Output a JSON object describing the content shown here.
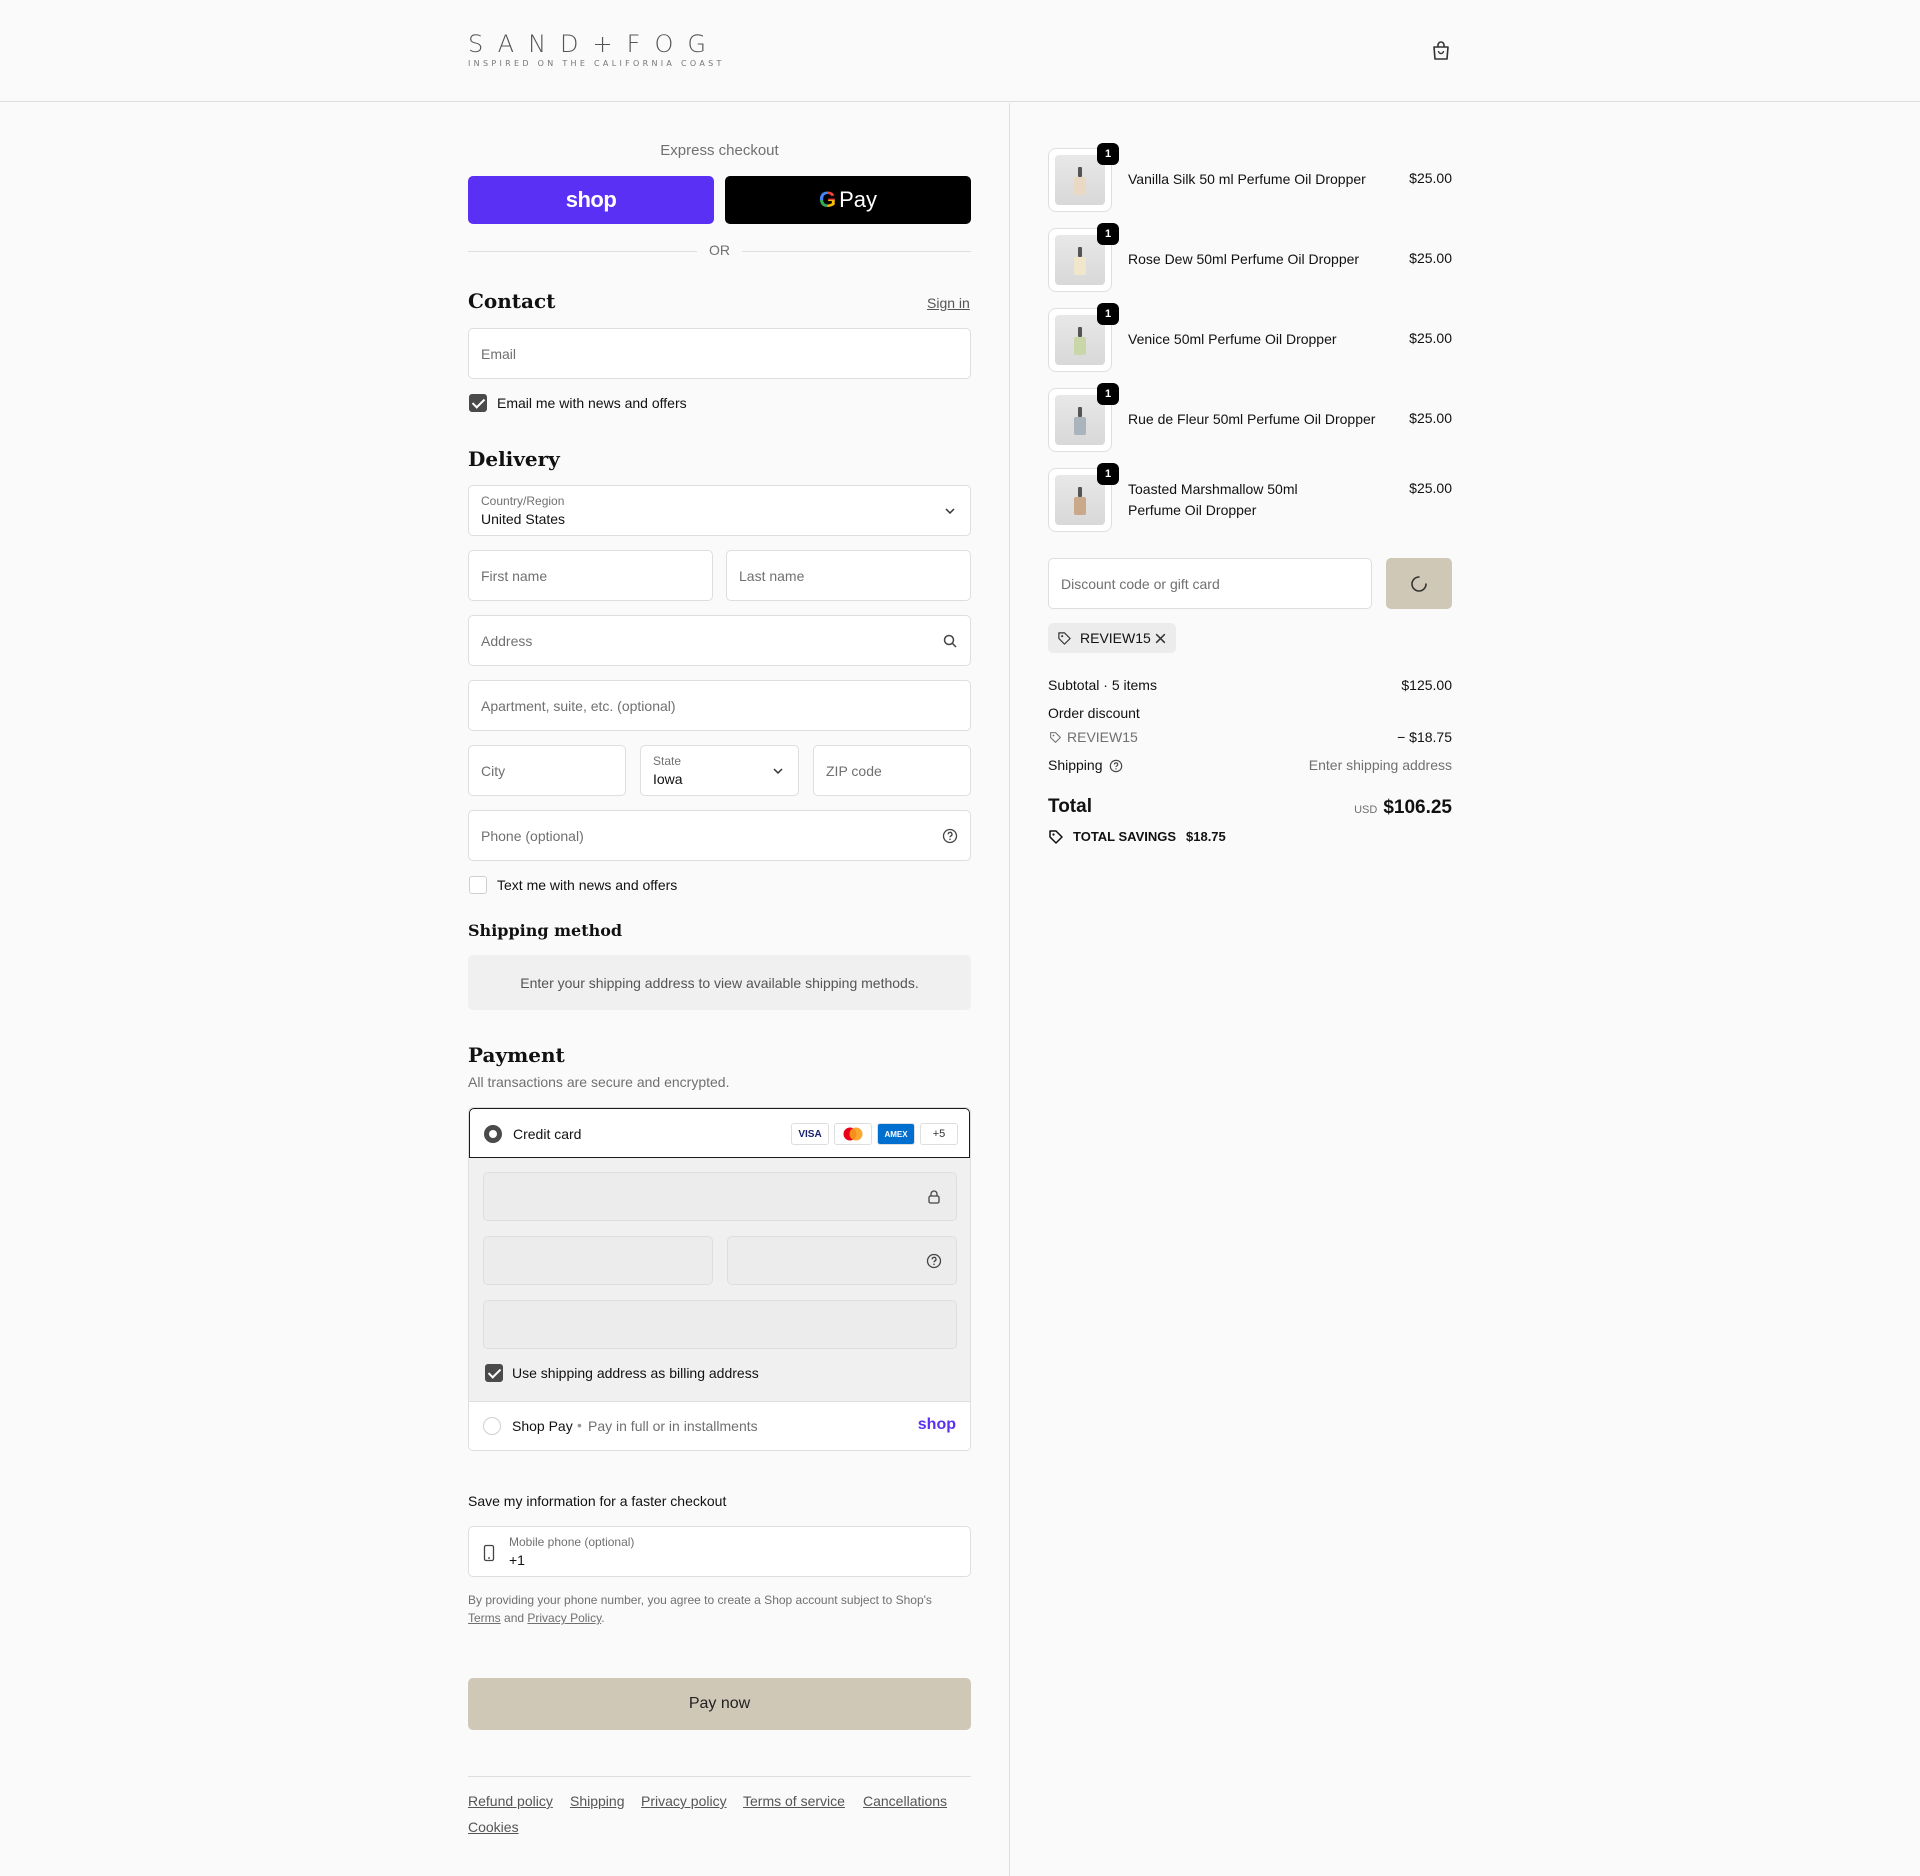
{
  "header": {
    "logo_main": "SAND+FOG",
    "logo_sub": "INSPIRED ON THE CALIFORNIA COAST"
  },
  "express": {
    "title": "Express checkout",
    "shop_label": "shop",
    "gpay_label": "Pay",
    "or": "OR"
  },
  "contact": {
    "heading": "Contact",
    "sign_in": "Sign in",
    "email_placeholder": "Email",
    "news_label": "Email me with news and offers",
    "news_checked": true
  },
  "delivery": {
    "heading": "Delivery",
    "country_label": "Country/Region",
    "country_value": "United States",
    "first_name": "First name",
    "last_name": "Last name",
    "address": "Address",
    "apartment": "Apartment, suite, etc. (optional)",
    "city": "City",
    "state_label": "State",
    "state_value": "Iowa",
    "zip": "ZIP code",
    "phone": "Phone (optional)",
    "text_label": "Text me with news and offers",
    "text_checked": false
  },
  "shipping_method": {
    "heading": "Shipping method",
    "note": "Enter your shipping address to view available shipping methods."
  },
  "payment": {
    "heading": "Payment",
    "subtext": "All transactions are secure and encrypted.",
    "credit_card": "Credit card",
    "brands": [
      "VISA",
      "MC",
      "AMEX",
      "+5"
    ],
    "billing_label": "Use shipping address as billing address",
    "shop_pay": "Shop Pay",
    "shop_pay_sub": "Pay in full or in installments",
    "shop_logo": "shop"
  },
  "save_info": {
    "heading": "Save my information for a faster checkout",
    "mobile_label": "Mobile phone (optional)",
    "mobile_value": "+1",
    "legal_1": "By providing your phone number, you agree to create a Shop account subject to Shop's",
    "terms": "Terms",
    "and": "and",
    "privacy": "Privacy Policy",
    "period": "."
  },
  "pay_now": "Pay now",
  "footer_links": [
    "Refund policy",
    "Shipping",
    "Privacy policy",
    "Terms of service",
    "Cancellations",
    "Cookies"
  ],
  "cart": {
    "items": [
      {
        "name": "Vanilla Silk 50 ml Perfume Oil Dropper",
        "price": "$25.00",
        "qty": "1",
        "color": "#e9d9c4"
      },
      {
        "name": "Rose Dew 50ml Perfume Oil Dropper",
        "price": "$25.00",
        "qty": "1",
        "color": "#efe6cc"
      },
      {
        "name": "Venice 50ml Perfume Oil Dropper",
        "price": "$25.00",
        "qty": "1",
        "color": "#c8d6a8"
      },
      {
        "name": "Rue de Fleur 50ml Perfume Oil Dropper",
        "price": "$25.00",
        "qty": "1",
        "color": "#a9b4bd"
      },
      {
        "name": "Toasted Marshmallow 50ml Perfume Oil Dropper",
        "price": "$25.00",
        "qty": "1",
        "color": "#c9a98a"
      }
    ],
    "discount_placeholder": "Discount code or gift card",
    "applied_code": "REVIEW15",
    "subtotal_label": "Subtotal · 5 items",
    "subtotal_value": "$125.00",
    "order_discount": "Order discount",
    "discount_code": "REVIEW15",
    "discount_value": "− $18.75",
    "shipping_label": "Shipping",
    "shipping_value": "Enter shipping address",
    "total_label": "Total",
    "currency": "USD",
    "total_value": "$106.25",
    "savings_label": "TOTAL SAVINGS",
    "savings_value": "$18.75"
  },
  "colors": {
    "shop_purple": "#5a31f4",
    "pay_now_bg": "#d0c8b6",
    "apply_btn_bg": "#d0c8b6"
  }
}
